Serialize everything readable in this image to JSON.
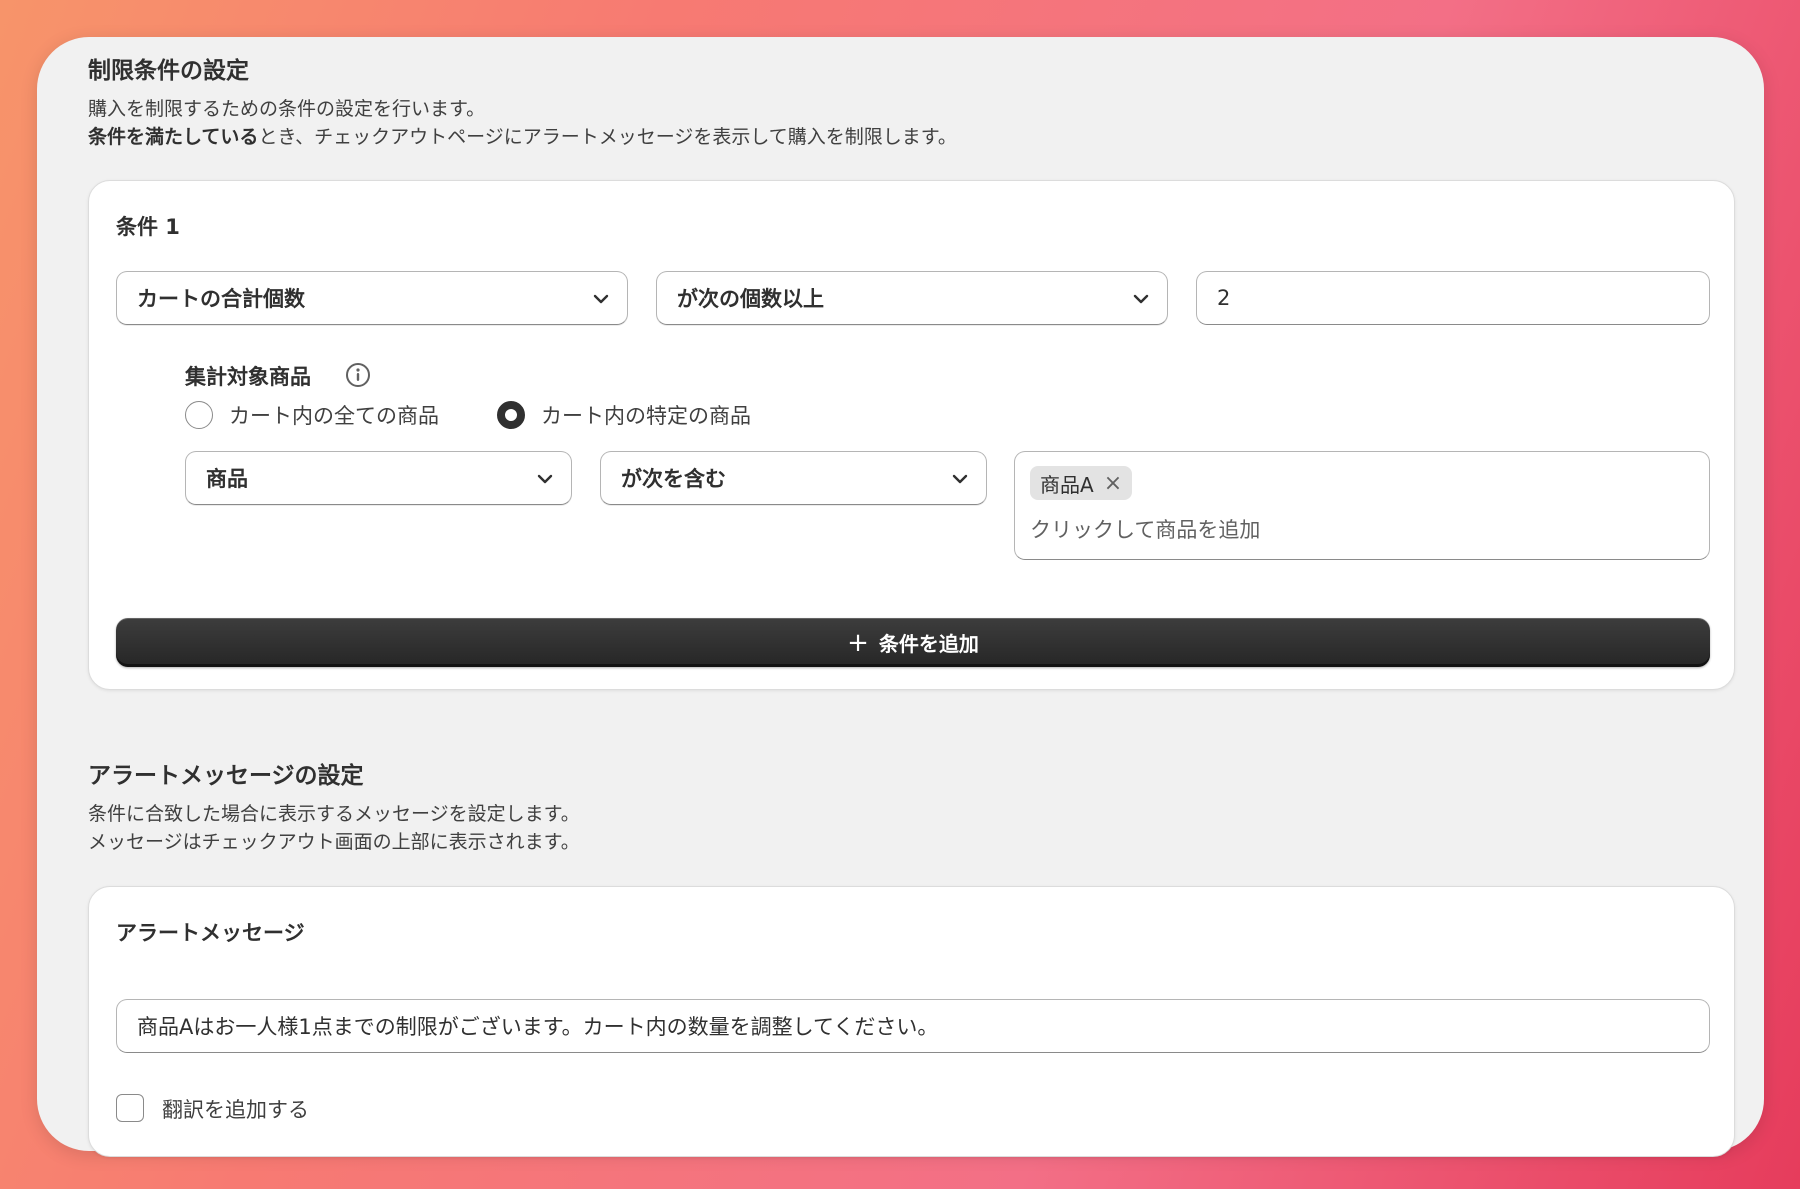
{
  "restriction": {
    "title": "制限条件の設定",
    "desc_line1": "購入を制限するための条件の設定を行います。",
    "desc_line2_bold": "条件を満たしている",
    "desc_line2_rest": "とき、チェックアウトページにアラートメッセージを表示して購入を制限します。"
  },
  "condition": {
    "title": "条件 1",
    "field_select": "カートの合計個数",
    "operator_select": "が次の個数以上",
    "value": "2",
    "target_label": "集計対象商品",
    "radio_all": "カート内の全ての商品",
    "radio_specific": "カート内の特定の商品",
    "radio_selected": "specific",
    "product_select": "商品",
    "product_operator_select": "が次を含む",
    "tag": "商品A",
    "tag_remove": "×",
    "tag_placeholder": "クリックして商品を追加",
    "add_button": "条件を追加",
    "add_plus": "+"
  },
  "alert": {
    "title": "アラートメッセージの設定",
    "desc_line1": "条件に合致した場合に表示するメッセージを設定します。",
    "desc_line2": "メッセージはチェックアウト画面の上部に表示されます。",
    "card_title": "アラートメッセージ",
    "message": "商品Aはお一人様1点までの制限がございます。カート内の数量を調整してください。",
    "translation_checkbox": "翻訳を追加する",
    "translation_checked": false
  },
  "icons": {
    "chevron": "chevron-down-icon",
    "info": "info-icon"
  }
}
